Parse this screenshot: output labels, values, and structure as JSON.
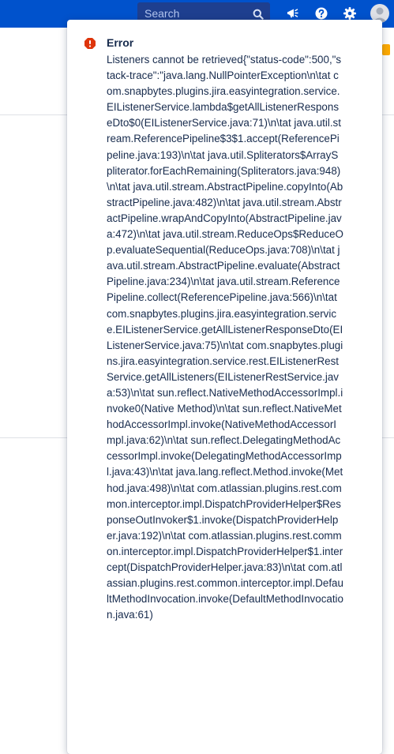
{
  "header": {
    "search_placeholder": "Search",
    "icons": [
      "search-icon",
      "megaphone-icon",
      "help-icon",
      "gear-icon",
      "avatar"
    ]
  },
  "colors": {
    "topbar": "#0052cc",
    "search_bg": "#1e3f8f",
    "error_red": "#de350b",
    "text": "#172b4d"
  },
  "flag": {
    "icon": "error-icon",
    "title": "Error",
    "message": "Listeners cannot be retrieved{\"status-code\":500,\"stack-trace\":\"java.lang.NullPointerException\\n\\tat com.snapbytes.plugins.jira.easyintegration.service.EIListenerService.lambda$getAllListenerResponseDto$0(EIListenerService.java:71)\\n\\tat java.util.stream.ReferencePipeline$3$1.accept(ReferencePipeline.java:193)\\n\\tat java.util.Spliterators$ArraySpliterator.forEachRemaining(Spliterators.java:948)\\n\\tat java.util.stream.AbstractPipeline.copyInto(AbstractPipeline.java:482)\\n\\tat java.util.stream.AbstractPipeline.wrapAndCopyInto(AbstractPipeline.java:472)\\n\\tat java.util.stream.ReduceOps$ReduceOp.evaluateSequential(ReduceOps.java:708)\\n\\tat java.util.stream.AbstractPipeline.evaluate(AbstractPipeline.java:234)\\n\\tat java.util.stream.ReferencePipeline.collect(ReferencePipeline.java:566)\\n\\tat com.snapbytes.plugins.jira.easyintegration.service.EIListenerService.getAllListenerResponseDto(EIListenerService.java:75)\\n\\tat com.snapbytes.plugins.jira.easyintegration.service.rest.EIListenerRestService.getAllListeners(EIListenerRestService.java:53)\\n\\tat sun.reflect.NativeMethodAccessorImpl.invoke0(Native Method)\\n\\tat sun.reflect.NativeMethodAccessorImpl.invoke(NativeMethodAccessorImpl.java:62)\\n\\tat sun.reflect.DelegatingMethodAccessorImpl.invoke(DelegatingMethodAccessorImpl.java:43)\\n\\tat java.lang.reflect.Method.invoke(Method.java:498)\\n\\tat com.atlassian.plugins.rest.common.interceptor.impl.DispatchProviderHelper$ResponseOutInvoker$1.invoke(DispatchProviderHelper.java:192)\\n\\tat com.atlassian.plugins.rest.common.interceptor.impl.DispatchProviderHelper$1.intercept(DispatchProviderHelper.java:83)\\n\\tat com.atlassian.plugins.rest.common.interceptor.impl.DefaultMethodInvocation.invoke(DefaultMethodInvocation.java:61)"
  }
}
